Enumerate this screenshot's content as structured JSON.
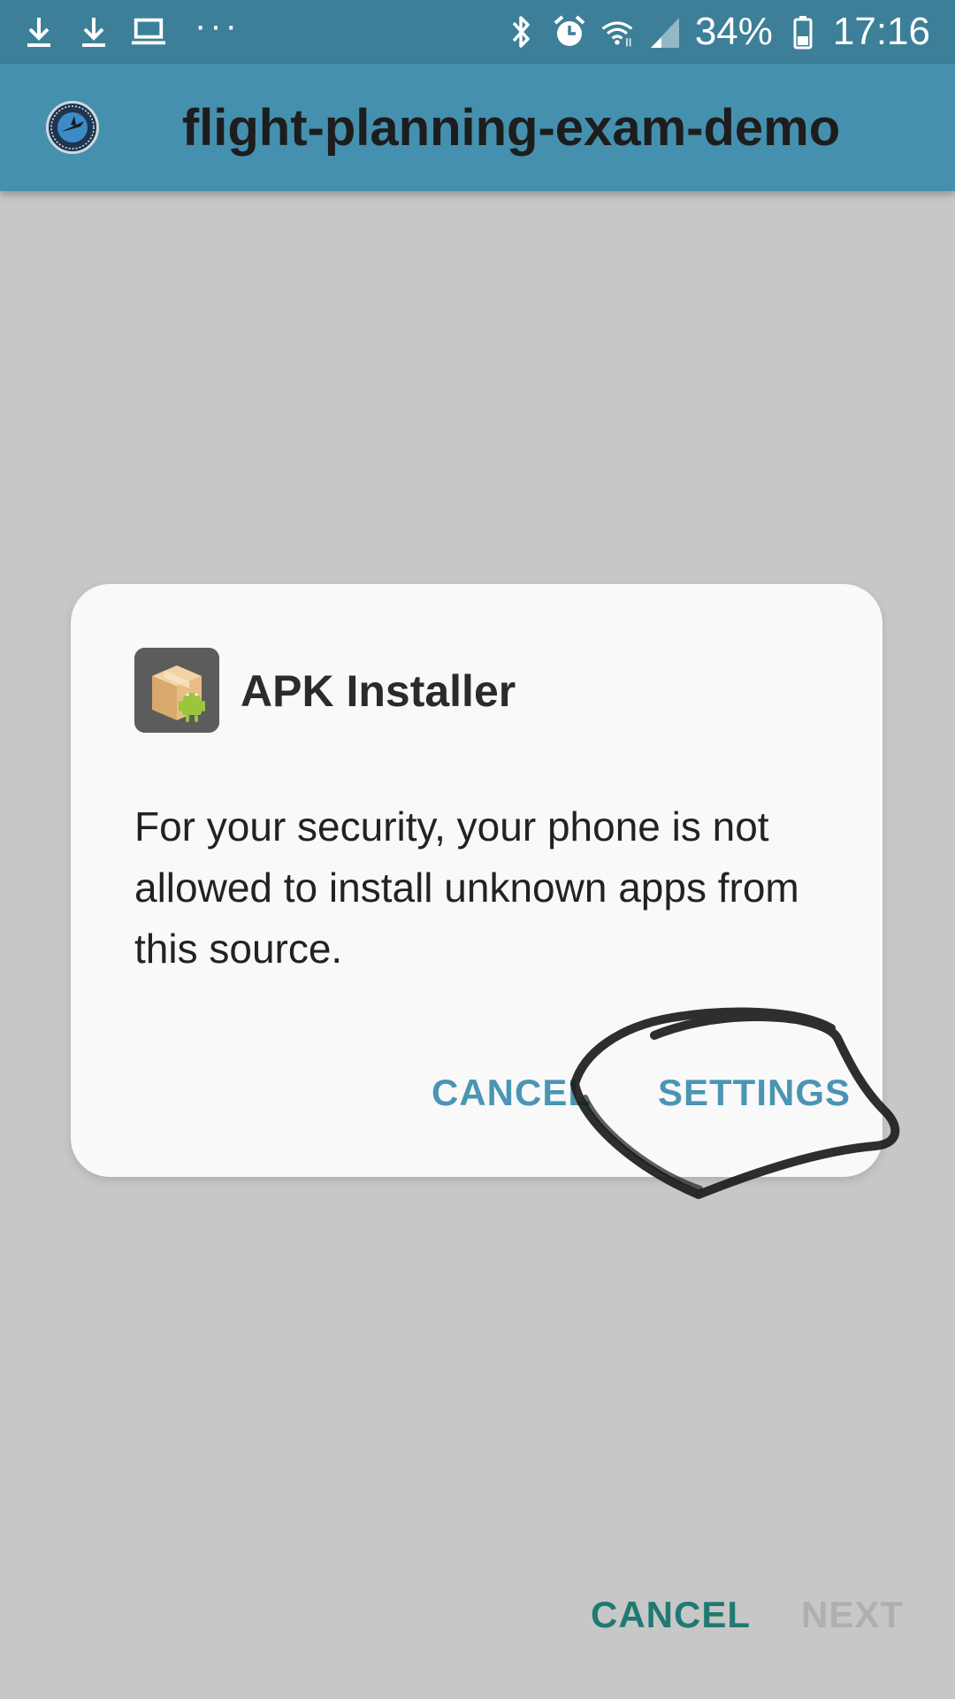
{
  "status_bar": {
    "left_icons": [
      "download-icon",
      "download-icon",
      "laptop-icon"
    ],
    "more": "···",
    "right_icons": [
      "bluetooth-icon",
      "alarm-icon",
      "wifi-icon",
      "signal-icon",
      "battery-icon"
    ],
    "battery": "34%",
    "time": "17:16"
  },
  "app_bar": {
    "title": "flight-planning-exam-demo",
    "logo": "college-of-aeronautical-science-logo"
  },
  "dialog": {
    "app_name": "APK Installer",
    "app_icon": "package-android-icon",
    "message": "For your security, your phone is not allowed to install unknown apps from this source.",
    "cancel_label": "CANCEL",
    "settings_label": "SETTINGS"
  },
  "bottom": {
    "cancel_label": "CANCEL",
    "next_label": "NEXT"
  },
  "colors": {
    "status_bar": "#3d7f99",
    "app_bar": "#4590ae",
    "overlay": "#c7c7c7",
    "dialog_button": "#4a95b3",
    "bottom_cancel": "#1f7a72",
    "bottom_next_disabled": "#afafaf"
  }
}
